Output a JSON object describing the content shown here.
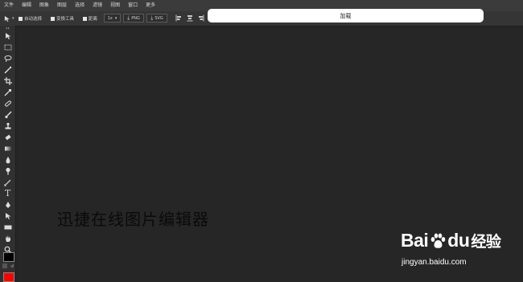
{
  "menu": [
    "文件",
    "编辑",
    "图象",
    "图层",
    "选择",
    "滤镜",
    "视图",
    "窗口",
    "更多"
  ],
  "options": {
    "auto_select": "自动选择",
    "transform_tools": "变换工具",
    "distance": "距离",
    "zoom_value": "1x",
    "png_button": "PNG",
    "svg_button": "SVG"
  },
  "loading_text": "加载",
  "watermark_text": "迅捷在线图片编辑器",
  "logo": {
    "bai": "Bai",
    "du": "du",
    "jingyan": "经验",
    "url": "jingyan.baidu.com"
  },
  "colors": {
    "foreground": "#000000",
    "background": "#ff0000"
  },
  "tools": [
    "move-icon",
    "marquee-icon",
    "lasso-icon",
    "magic-wand-icon",
    "crop-icon",
    "eyedropper-icon",
    "healing-icon",
    "brush-icon",
    "stamp-icon",
    "eraser-icon",
    "gradient-icon",
    "blur-icon",
    "dodge-icon",
    "pen-icon",
    "type-icon",
    "path-select-icon",
    "rectangle-icon",
    "hand-icon",
    "zoom-icon"
  ]
}
